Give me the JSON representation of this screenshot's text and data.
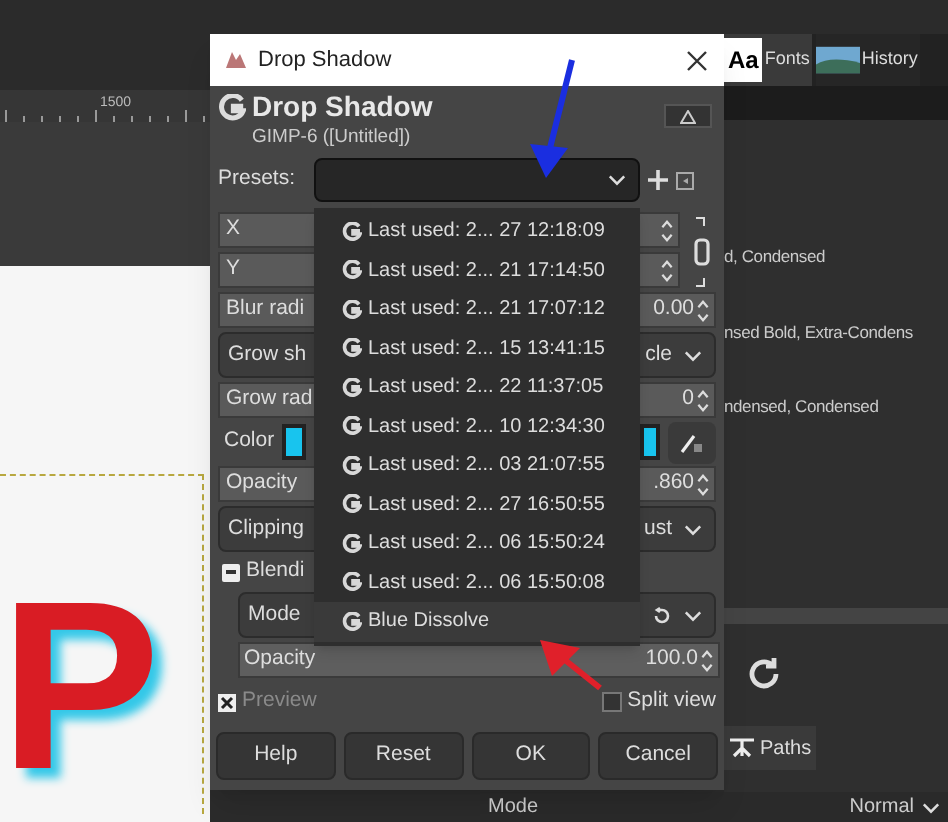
{
  "ruler": {
    "label": "1500"
  },
  "canvas": {
    "text": "P"
  },
  "right_panel": {
    "tabs": [
      {
        "icon_text": "Aa",
        "label": "Fonts",
        "selected": true
      },
      {
        "label": "History",
        "selected": false
      }
    ],
    "font_items": [
      "d, Condensed",
      "nsed Bold, Extra-Condens",
      "ndensed, Condensed"
    ],
    "bottom_tab": "Paths",
    "mode": {
      "label": "Mode",
      "value": "Normal"
    }
  },
  "dialog": {
    "title": "Drop Shadow",
    "header": {
      "title": "Drop Shadow",
      "subtitle": "GIMP-6 ([Untitled])"
    },
    "presets": {
      "label": "Presets:"
    },
    "rows": [
      {
        "kind": "spin",
        "label": "X"
      },
      {
        "kind": "spin",
        "label": "Y"
      },
      {
        "kind": "spin",
        "label": "Blur radi",
        "value": "0.00"
      },
      {
        "kind": "combo",
        "label": "Grow sh",
        "value": "cle"
      },
      {
        "kind": "spin",
        "label": "Grow rad",
        "value": "0"
      },
      {
        "kind": "color",
        "label": "Color",
        "color": "#18c4ee"
      },
      {
        "kind": "spin",
        "label": "Opacity",
        "value": ".860"
      },
      {
        "kind": "combo",
        "label": "Clipping",
        "value": "ust"
      },
      {
        "kind": "expander",
        "label": "Blendi",
        "expanded": true
      },
      {
        "kind": "mode",
        "label": "Mode"
      },
      {
        "kind": "full",
        "label": "Opacity",
        "value": "100.0",
        "level": 1
      }
    ],
    "preview": {
      "label": "Preview",
      "checked": true
    },
    "split_view": {
      "label": "Split view",
      "checked": false
    },
    "buttons": [
      "Help",
      "Reset",
      "OK",
      "Cancel"
    ],
    "dropdown": [
      {
        "label": "Last used: 2... 27 12:18:09",
        "selected": false
      },
      {
        "label": "Last used: 2... 21 17:14:50",
        "selected": false
      },
      {
        "label": "Last used: 2... 21 17:07:12",
        "selected": false
      },
      {
        "label": "Last used: 2... 15 13:41:15",
        "selected": false
      },
      {
        "label": "Last used: 2... 22 11:37:05",
        "selected": false
      },
      {
        "label": "Last used: 2... 10 12:34:30",
        "selected": false
      },
      {
        "label": "Last used: 2... 03 21:07:55",
        "selected": false
      },
      {
        "label": "Last used: 2... 27 16:50:55",
        "selected": false
      },
      {
        "label": "Last used: 2... 06 15:50:24",
        "selected": false
      },
      {
        "label": "Last used: 2... 06 15:50:08",
        "selected": false
      },
      {
        "label": "Blue Dissolve",
        "selected": true
      }
    ]
  }
}
